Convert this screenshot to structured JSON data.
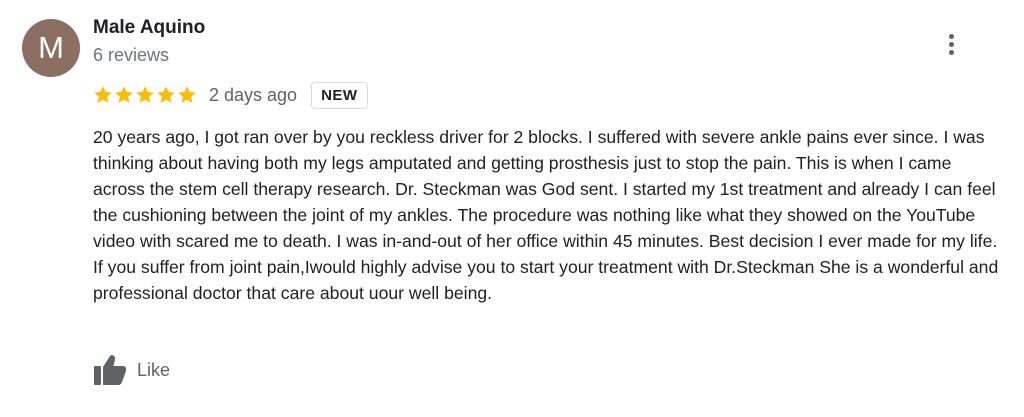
{
  "review": {
    "author": {
      "initial": "M",
      "avatar_color": "#8d6e63",
      "name": "Male Aquino",
      "reviews_count": "6 reviews"
    },
    "menu_icon": "more-vertical-icon",
    "rating": {
      "stars": 5,
      "max": 5,
      "star_color": "#fbbc04"
    },
    "date": "2 days ago",
    "badge": "NEW",
    "text": "20 years ago,  I got ran over by you reckless driver for 2 blocks. I suffered with severe ankle pains ever since. I was thinking about having both my legs amputated and getting prosthesis just to stop the pain. This is when I came across the stem cell therapy research.  Dr. Steckman was God sent.  I started my 1st treatment and already I can feel the cushioning between the joint of my ankles.  The procedure was nothing like what they showed on the YouTube video with scared me to death. I was in-and-out of her office within 45 minutes.  Best decision I ever made for my life.  If you suffer from joint pain,Iwould highly advise you to start your treatment with Dr.Steckman She is a wonderful and professional doctor that care about uour well being.",
    "like": {
      "icon": "thumbs-up-icon",
      "label": "Like"
    }
  }
}
